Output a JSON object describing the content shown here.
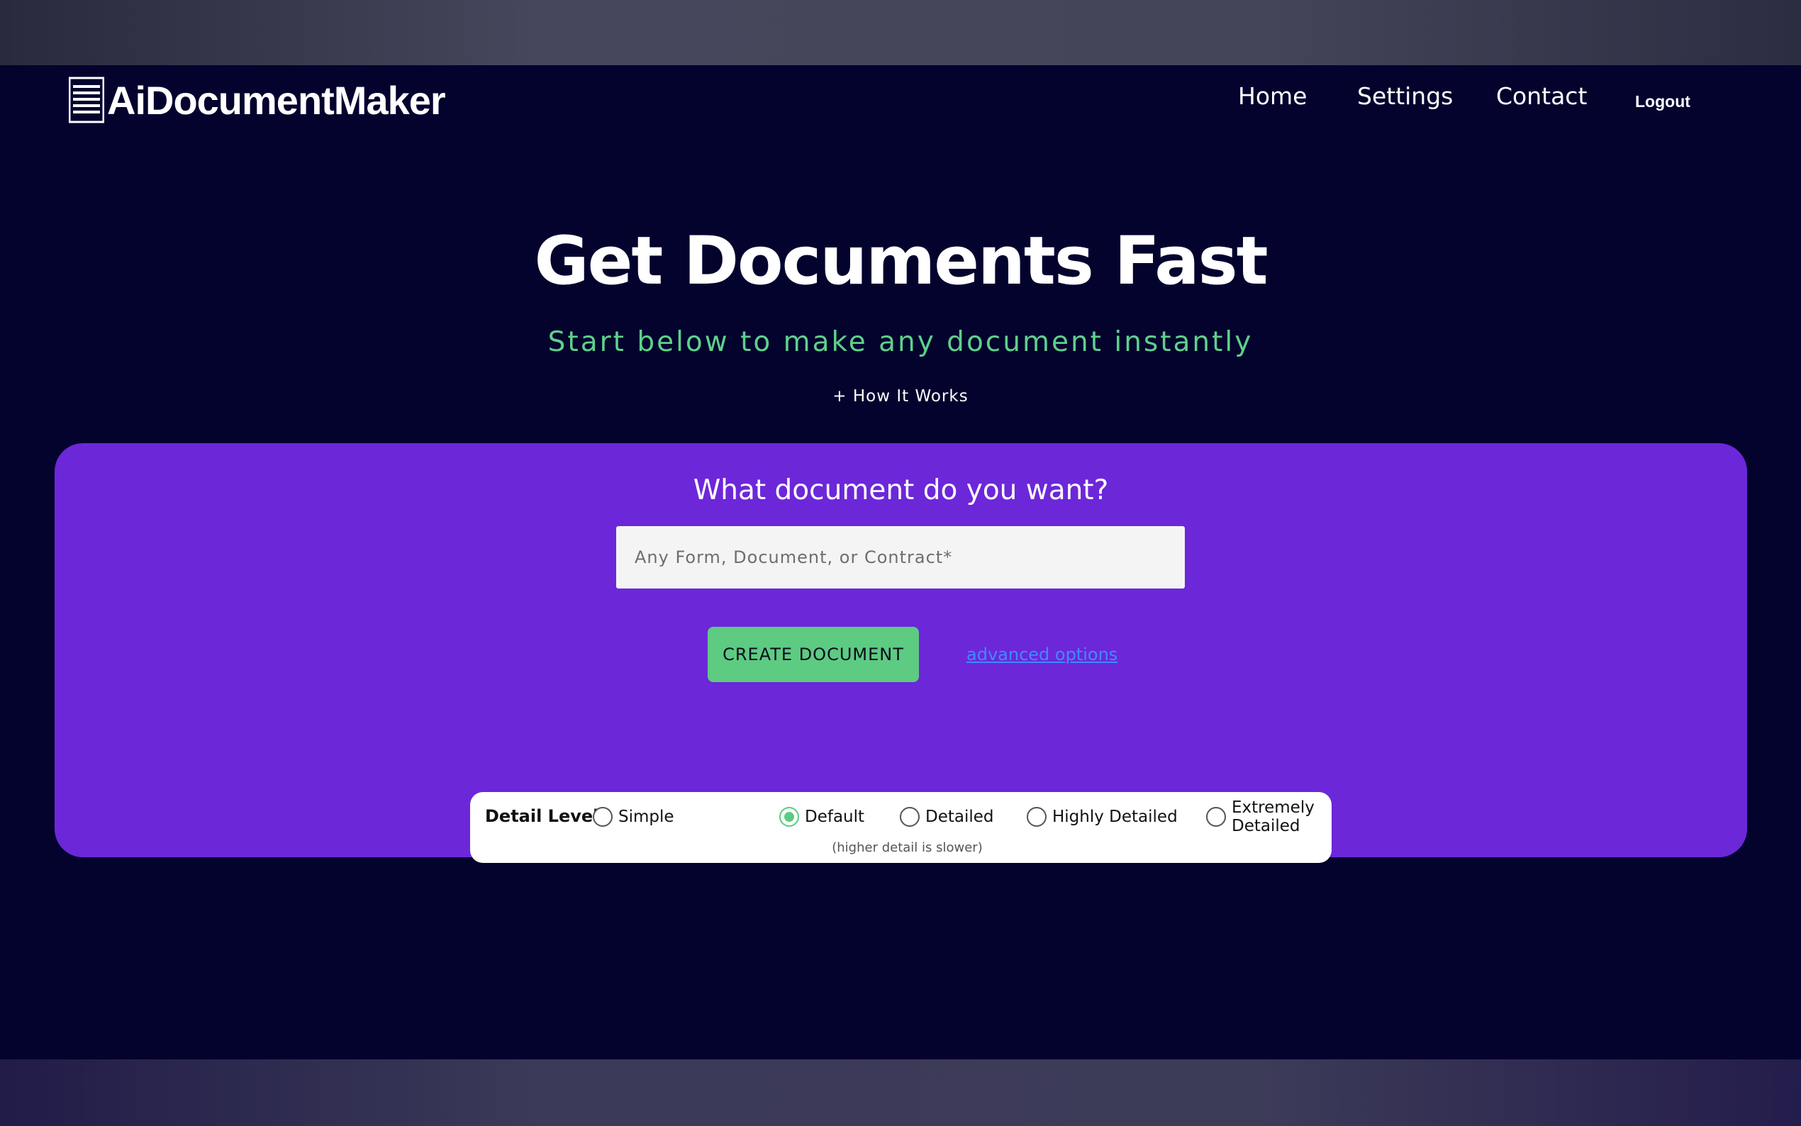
{
  "brand": {
    "name": "AiDocumentMaker",
    "logo_icon": "document-lines-icon"
  },
  "nav": {
    "home": "Home",
    "settings": "Settings",
    "contact": "Contact",
    "logout": "Logout"
  },
  "hero": {
    "title": "Get Documents Fast",
    "subtitle": "Start below to make any document instantly",
    "how_it_works": "+ How It Works"
  },
  "form": {
    "question": "What document do you want?",
    "input_placeholder": "Any Form, Document, or Contract*",
    "input_value": "",
    "create_button": "CREATE DOCUMENT",
    "advanced_link": "advanced options"
  },
  "detail": {
    "label": "Detail Level",
    "options": [
      {
        "label": "Simple",
        "checked": false
      },
      {
        "label": "Default",
        "checked": true
      },
      {
        "label": "Detailed",
        "checked": false
      },
      {
        "label": "Highly Detailed",
        "checked": false
      },
      {
        "label": "Extremely Detailed",
        "checked": false
      }
    ],
    "note": "(higher detail is slower)"
  },
  "colors": {
    "background": "#03032e",
    "card": "#6c27d9",
    "accent_green": "#5dcb82",
    "link_blue": "#3d8bff"
  }
}
